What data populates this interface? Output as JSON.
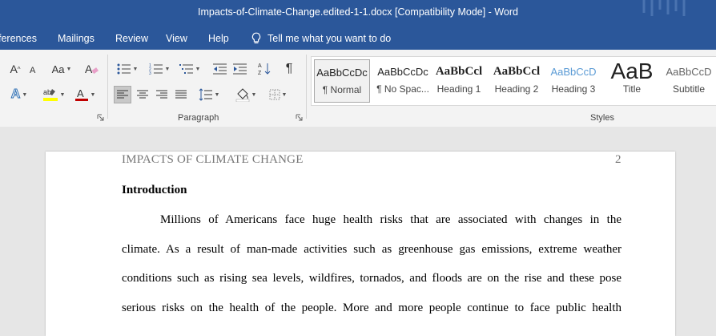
{
  "window": {
    "title": "Impacts-of-Climate-Change.edited-1-1.docx [Compatibility Mode]  -  Word"
  },
  "tabs": [
    "ferences",
    "Mailings",
    "Review",
    "View",
    "Help"
  ],
  "tell_me": {
    "placeholder": "Tell me what you want to do"
  },
  "ribbon": {
    "font_buttons": {
      "grow": "A",
      "case": "Aa",
      "font_color": "A",
      "text_effects": "A"
    },
    "groups": {
      "paragraph": "Paragraph",
      "styles": "Styles"
    },
    "styles": [
      {
        "sample": "AaBbCcDc",
        "name": "¶ Normal",
        "selected": true
      },
      {
        "sample": "AaBbCcDc",
        "name": "¶ No Spac..."
      },
      {
        "sample": "AaBbCcl",
        "name": "Heading 1"
      },
      {
        "sample": "AaBbCcl",
        "name": "Heading 2"
      },
      {
        "sample": "AaBbCcD",
        "name": "Heading 3"
      },
      {
        "sample": "AaB",
        "name": "Title"
      },
      {
        "sample": "AaBbCcD",
        "name": "Subtitle"
      }
    ]
  },
  "document": {
    "header": "IMPACTS OF CLIMATE CHANGE",
    "page_number": "2",
    "heading": "Introduction",
    "lines": [
      "Millions of Americans face huge health risks that are associated with changes in the",
      "climate. As a result of man-made activities such as greenhouse gas emissions, extreme weather",
      "conditions such as rising sea levels, wildfires, tornados, and floods are on the rise and these pose",
      "serious risks on the health of the people. More and more people continue to face public health"
    ]
  },
  "colors": {
    "accent": "#2b579a",
    "heading3": "#5b9bd5",
    "font_color_bar": "#c00000",
    "highlight": "#ffff00"
  }
}
